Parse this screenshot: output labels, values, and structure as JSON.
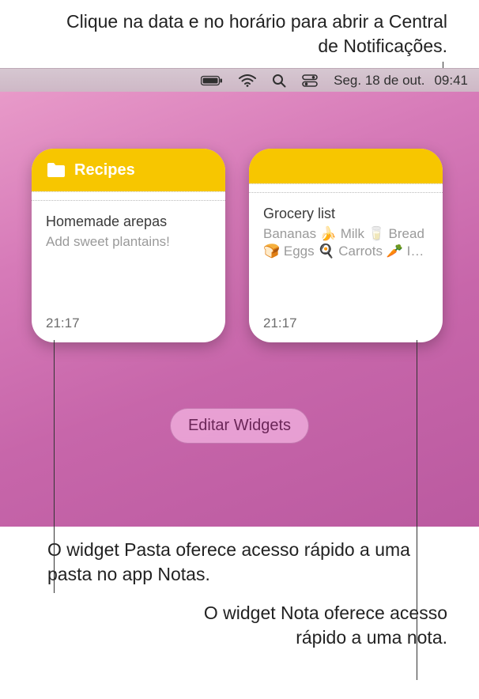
{
  "annotations": {
    "top": "Clique na data e no horário para abrir a Central de Notificações.",
    "bottom_left": "O widget Pasta oferece acesso rápido a uma pasta no app Notas.",
    "bottom_right": "O widget Nota oferece acesso rápido a uma nota."
  },
  "menubar": {
    "date": "Seg. 18 de out.",
    "time": "09:41"
  },
  "widgets": {
    "folder": {
      "title": "Recipes",
      "note_title": "Homemade arepas",
      "note_preview": "Add sweet plantains!",
      "time": "21:17"
    },
    "note": {
      "title": "Grocery list",
      "preview": "Bananas 🍌 Milk 🥛 Bread 🍞 Eggs 🍳 Carrots 🥕 I…",
      "time": "21:17"
    }
  },
  "edit_button": "Editar Widgets"
}
